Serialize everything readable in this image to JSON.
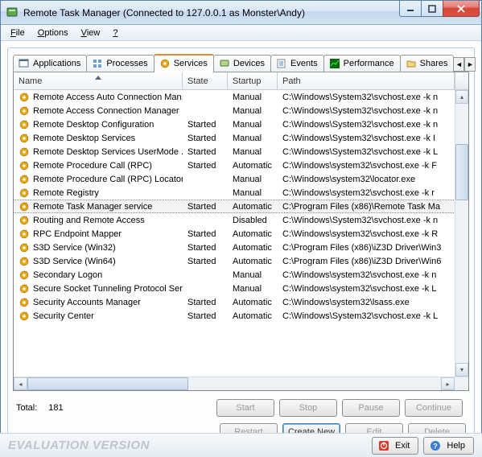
{
  "window": {
    "title": "Remote Task Manager (Connected to 127.0.0.1 as Monster\\Andy)"
  },
  "menu": {
    "file": "File",
    "options": "Options",
    "view": "View",
    "help": "?"
  },
  "tabs": {
    "applications": "Applications",
    "processes": "Processes",
    "services": "Services",
    "devices": "Devices",
    "events": "Events",
    "performance": "Performance",
    "shares": "Shares"
  },
  "columns": {
    "name": "Name",
    "state": "State",
    "startup": "Startup",
    "path": "Path"
  },
  "rows": [
    {
      "name": "Remote Access Auto Connection Man...",
      "state": "",
      "startup": "Manual",
      "path": "C:\\Windows\\System32\\svchost.exe -k n"
    },
    {
      "name": "Remote Access Connection Manager",
      "state": "",
      "startup": "Manual",
      "path": "C:\\Windows\\System32\\svchost.exe -k n"
    },
    {
      "name": "Remote Desktop Configuration",
      "state": "Started",
      "startup": "Manual",
      "path": "C:\\Windows\\System32\\svchost.exe -k n"
    },
    {
      "name": "Remote Desktop Services",
      "state": "Started",
      "startup": "Manual",
      "path": "C:\\Windows\\System32\\svchost.exe -k I"
    },
    {
      "name": "Remote Desktop Services UserMode ...",
      "state": "Started",
      "startup": "Manual",
      "path": "C:\\Windows\\System32\\svchost.exe -k L"
    },
    {
      "name": "Remote Procedure Call (RPC)",
      "state": "Started",
      "startup": "Automatic",
      "path": "C:\\Windows\\system32\\svchost.exe -k F"
    },
    {
      "name": "Remote Procedure Call (RPC) Locator",
      "state": "",
      "startup": "Manual",
      "path": "C:\\Windows\\system32\\locator.exe"
    },
    {
      "name": "Remote Registry",
      "state": "",
      "startup": "Manual",
      "path": "C:\\Windows\\system32\\svchost.exe -k r"
    },
    {
      "name": "Remote Task Manager service",
      "state": "Started",
      "startup": "Automatic",
      "path": "C:\\Program Files (x86)\\Remote Task Ma",
      "sel": true
    },
    {
      "name": "Routing and Remote Access",
      "state": "",
      "startup": "Disabled",
      "path": "C:\\Windows\\System32\\svchost.exe -k n"
    },
    {
      "name": "RPC Endpoint Mapper",
      "state": "Started",
      "startup": "Automatic",
      "path": "C:\\Windows\\system32\\svchost.exe -k R"
    },
    {
      "name": "S3D Service (Win32)",
      "state": "Started",
      "startup": "Automatic",
      "path": "C:\\Program Files (x86)\\iZ3D Driver\\Win3"
    },
    {
      "name": "S3D Service (Win64)",
      "state": "Started",
      "startup": "Automatic",
      "path": "C:\\Program Files (x86)\\iZ3D Driver\\Win6"
    },
    {
      "name": "Secondary Logon",
      "state": "",
      "startup": "Manual",
      "path": "C:\\Windows\\system32\\svchost.exe -k n"
    },
    {
      "name": "Secure Socket Tunneling Protocol Ser...",
      "state": "",
      "startup": "Manual",
      "path": "C:\\Windows\\system32\\svchost.exe -k L"
    },
    {
      "name": "Security Accounts Manager",
      "state": "Started",
      "startup": "Automatic",
      "path": "C:\\Windows\\system32\\lsass.exe"
    },
    {
      "name": "Security Center",
      "state": "Started",
      "startup": "Automatic",
      "path": "C:\\Windows\\System32\\svchost.exe -k L"
    }
  ],
  "total": {
    "label": "Total:",
    "value": "181"
  },
  "buttons": {
    "start": "Start",
    "stop": "Stop",
    "pause": "Pause",
    "continue": "Continue",
    "restart": "Restart",
    "create_new": "Create New",
    "edit": "Edit",
    "delete": "Delete"
  },
  "footer": {
    "eval": "EVALUATION VERSION",
    "exit": "Exit",
    "help": "Help"
  }
}
